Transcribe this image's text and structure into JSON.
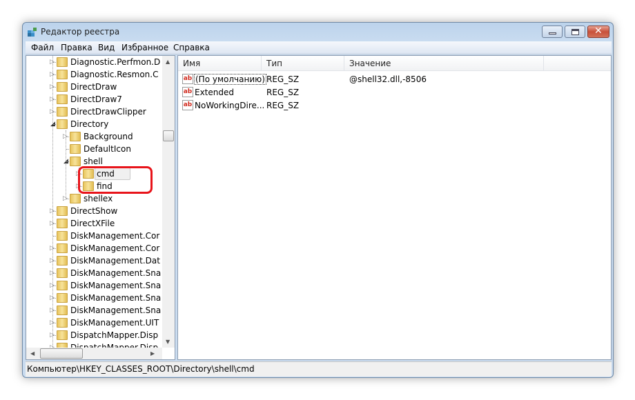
{
  "window": {
    "title": "Редактор реестра",
    "icon": "registry-editor-icon"
  },
  "menu": [
    "Файл",
    "Правка",
    "Вид",
    "Избранное",
    "Справка"
  ],
  "tree": {
    "rows": [
      {
        "label": "Diagnostic.Perfmon.D",
        "level": 1,
        "expander": "collapsed"
      },
      {
        "label": "Diagnostic.Resmon.C",
        "level": 1,
        "expander": "collapsed"
      },
      {
        "label": "DirectDraw",
        "level": 1,
        "expander": "collapsed"
      },
      {
        "label": "DirectDraw7",
        "level": 1,
        "expander": "collapsed"
      },
      {
        "label": "DirectDrawClipper",
        "level": 1,
        "expander": "collapsed"
      },
      {
        "label": "Directory",
        "level": 1,
        "expander": "expanded"
      },
      {
        "label": "Background",
        "level": 2,
        "expander": "collapsed"
      },
      {
        "label": "DefaultIcon",
        "level": 2,
        "expander": "none"
      },
      {
        "label": "shell",
        "level": 2,
        "expander": "expanded"
      },
      {
        "label": "cmd",
        "level": 3,
        "expander": "collapsed",
        "selected": true
      },
      {
        "label": "find",
        "level": 3,
        "expander": "collapsed"
      },
      {
        "label": "shellex",
        "level": 2,
        "expander": "collapsed"
      },
      {
        "label": "DirectShow",
        "level": 1,
        "expander": "collapsed"
      },
      {
        "label": "DirectXFile",
        "level": 1,
        "expander": "collapsed"
      },
      {
        "label": "DiskManagement.Cor",
        "level": 1,
        "expander": "none"
      },
      {
        "label": "DiskManagement.Cor",
        "level": 1,
        "expander": "collapsed"
      },
      {
        "label": "DiskManagement.Dat",
        "level": 1,
        "expander": "collapsed"
      },
      {
        "label": "DiskManagement.Sna",
        "level": 1,
        "expander": "collapsed"
      },
      {
        "label": "DiskManagement.Sna",
        "level": 1,
        "expander": "collapsed"
      },
      {
        "label": "DiskManagement.Sna",
        "level": 1,
        "expander": "collapsed"
      },
      {
        "label": "DiskManagement.Sna",
        "level": 1,
        "expander": "collapsed"
      },
      {
        "label": "DiskManagement.UIT",
        "level": 1,
        "expander": "collapsed"
      },
      {
        "label": "DispatchMapper.Disp",
        "level": 1,
        "expander": "collapsed"
      },
      {
        "label": "DispatchMapper.Disp",
        "level": 1,
        "expander": "collapsed"
      }
    ],
    "highlight_color": "#e8141a"
  },
  "values": {
    "columns": [
      "Имя",
      "Тип",
      "Значение"
    ],
    "rows": [
      {
        "name": "(По умолчанию)",
        "type": "REG_SZ",
        "data": "@shell32.dll,-8506",
        "icon": "string-value-icon"
      },
      {
        "name": "Extended",
        "type": "REG_SZ",
        "data": "",
        "icon": "string-value-icon"
      },
      {
        "name": "NoWorkingDire...",
        "type": "REG_SZ",
        "data": "",
        "icon": "string-value-icon"
      }
    ]
  },
  "status": "Компьютер\\HKEY_CLASSES_ROOT\\Directory\\shell\\cmd"
}
